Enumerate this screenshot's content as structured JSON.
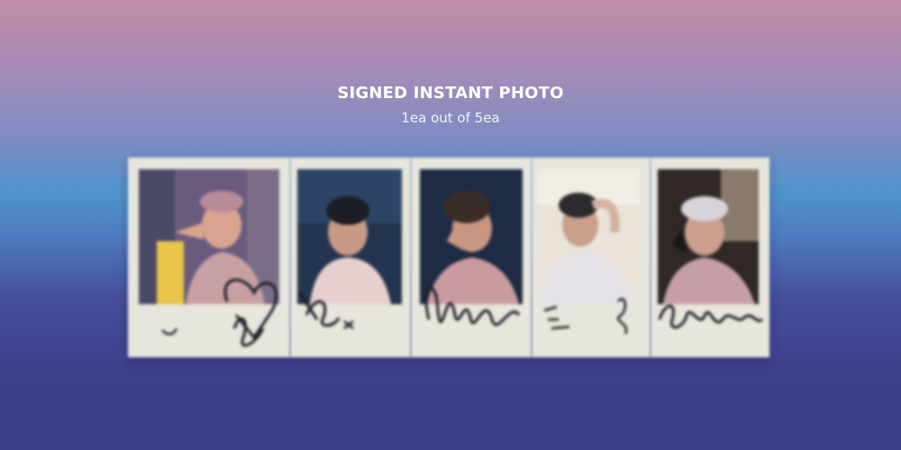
{
  "header": {
    "title": "SIGNED INSTANT PHOTO",
    "subtitle": "1ea out of 5ea"
  },
  "colors": {
    "background_top": "#c48da6",
    "background_mid": "#4e93cc",
    "background_bottom": "#3a3d88",
    "text": "#ffffff",
    "card_border": "#e7e6dc"
  },
  "photos": [
    {
      "name": "signed-instant-photo-1",
      "signature": "handwritten signature with heart"
    },
    {
      "name": "signed-instant-photo-2",
      "signature": "handwritten signature"
    },
    {
      "name": "signed-instant-photo-3",
      "signature": "handwritten signature"
    },
    {
      "name": "signed-instant-photo-4",
      "signature": "handwritten signature"
    },
    {
      "name": "signed-instant-photo-5",
      "signature": "handwritten signature"
    }
  ]
}
